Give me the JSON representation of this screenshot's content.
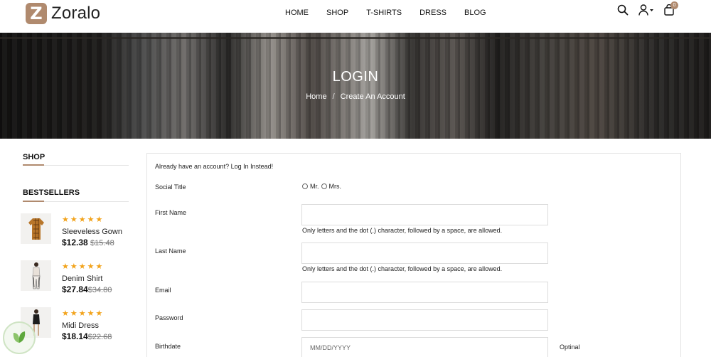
{
  "header": {
    "logo_letter": "Z",
    "logo_text": "Zoralo",
    "nav": [
      "HOME",
      "SHOP",
      "T-SHIRTS",
      "DRESS",
      "BLOG"
    ],
    "cart_count": "0",
    "icons": [
      "search-icon",
      "user-icon",
      "cart-icon"
    ]
  },
  "banner": {
    "title": "LOGIN",
    "breadcrumb": [
      "Home",
      "Create An Account"
    ],
    "breadcrumb_separator": "/"
  },
  "sidebar": {
    "shop_title": "SHOP",
    "bestsellers_title": "BESTSELLERS",
    "products": [
      {
        "name": "Sleeveless Gown",
        "price": "$12.38",
        "old_price": "$15.48",
        "stars": "★★★★★",
        "rating": 5
      },
      {
        "name": "Denim Shirt",
        "price": "$27.84",
        "old_price": "$34.80",
        "stars": "★★★★★",
        "rating": 5
      },
      {
        "name": "Midi Dress",
        "price": "$18.14",
        "old_price": "$22.68",
        "stars": "★★★★★",
        "rating": 5
      }
    ]
  },
  "form": {
    "login_prompt": "Already have an account? Log In Instead!",
    "social_title_label": "Social Title",
    "social_options": [
      "Mr.",
      "Mrs."
    ],
    "first_name_label": "First Name",
    "first_name_value": "",
    "last_name_label": "Last Name",
    "last_name_value": "",
    "name_helper": "Only letters and the dot (.) character, followed by a space, are allowed.",
    "email_label": "Email",
    "email_value": "",
    "password_label": "Password",
    "password_value": "",
    "birthdate_label": "Birthdate",
    "birthdate_placeholder": "MM/DD/YYYY",
    "birthdate_note": "Optinal"
  },
  "colors": {
    "accent": "#b08a6e",
    "star": "#f2a31b"
  }
}
